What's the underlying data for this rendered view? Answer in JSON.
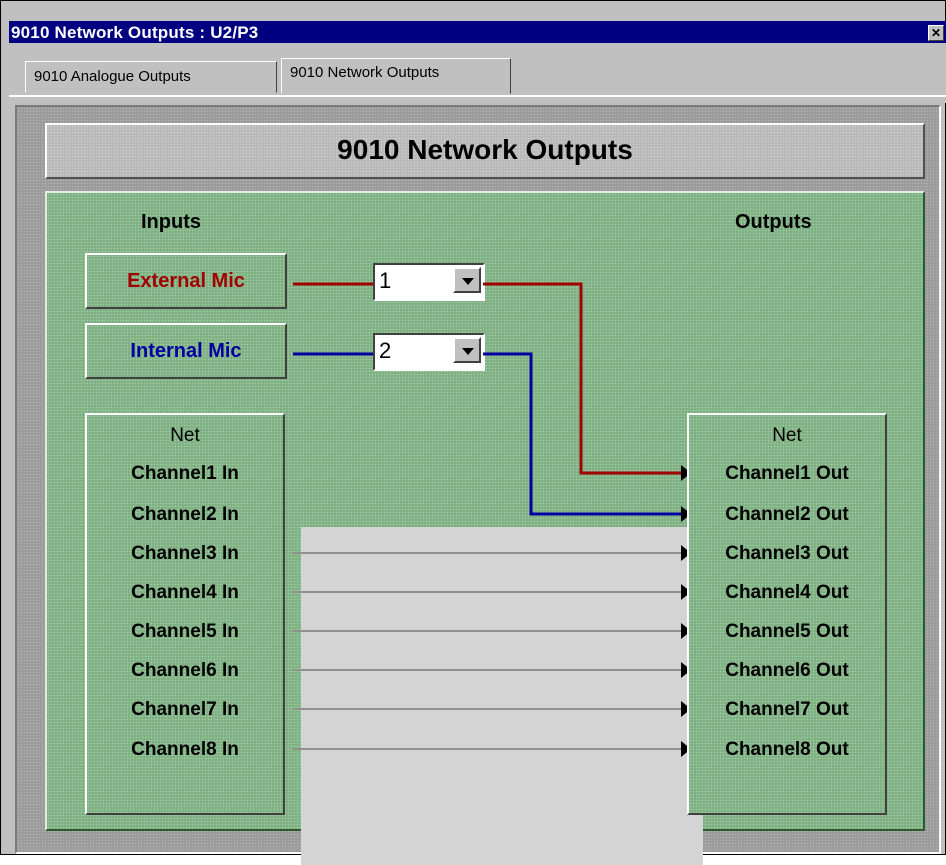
{
  "window": {
    "title": "9010 Network Outputs : U2/P3",
    "close_glyph": "✕"
  },
  "tabs": [
    {
      "label": "9010 Analogue Outputs",
      "active": false
    },
    {
      "label": "9010 Network Outputs",
      "active": true
    }
  ],
  "banner": {
    "title": "9010 Network Outputs"
  },
  "routing": {
    "inputs_label": "Inputs",
    "outputs_label": "Outputs",
    "sources": [
      {
        "label": "External Mic",
        "selected": "1",
        "color": "#a00000"
      },
      {
        "label": "Internal Mic",
        "selected": "2",
        "color": "#0000a0"
      }
    ],
    "net_in": {
      "header": "Net",
      "channels": [
        "Channel1 In",
        "Channel2 In",
        "Channel3 In",
        "Channel4 In",
        "Channel5 In",
        "Channel6 In",
        "Channel7 In",
        "Channel8 In"
      ]
    },
    "net_out": {
      "header": "Net",
      "channels": [
        "Channel1 Out",
        "Channel2 Out",
        "Channel3 Out",
        "Channel4 Out",
        "Channel5 Out",
        "Channel6 Out",
        "Channel7 Out",
        "Channel8 Out"
      ]
    }
  },
  "colors": {
    "panel_green": "#7fb083",
    "title_bar": "#000080",
    "wire_gray": "#909090"
  }
}
